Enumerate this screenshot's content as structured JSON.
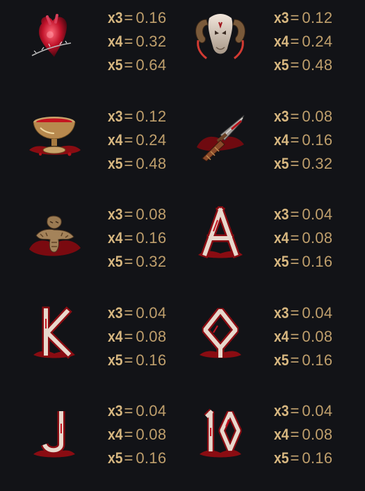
{
  "symbols": [
    {
      "name": "bleeding-heart",
      "icon": "heart-icon",
      "pays": [
        {
          "mult": "x3",
          "value": "0.16"
        },
        {
          "mult": "x4",
          "value": "0.32"
        },
        {
          "mult": "x5",
          "value": "0.64"
        }
      ]
    },
    {
      "name": "ram-skull",
      "icon": "ram-skull-icon",
      "pays": [
        {
          "mult": "x3",
          "value": "0.12"
        },
        {
          "mult": "x4",
          "value": "0.24"
        },
        {
          "mult": "x5",
          "value": "0.48"
        }
      ]
    },
    {
      "name": "blood-chalice",
      "icon": "chalice-icon",
      "pays": [
        {
          "mult": "x3",
          "value": "0.12"
        },
        {
          "mult": "x4",
          "value": "0.24"
        },
        {
          "mult": "x5",
          "value": "0.48"
        }
      ]
    },
    {
      "name": "ritual-dagger",
      "icon": "dagger-icon",
      "pays": [
        {
          "mult": "x3",
          "value": "0.08"
        },
        {
          "mult": "x4",
          "value": "0.16"
        },
        {
          "mult": "x5",
          "value": "0.32"
        }
      ]
    },
    {
      "name": "voodoo-doll",
      "icon": "voodoo-doll-icon",
      "pays": [
        {
          "mult": "x3",
          "value": "0.08"
        },
        {
          "mult": "x4",
          "value": "0.16"
        },
        {
          "mult": "x5",
          "value": "0.32"
        }
      ]
    },
    {
      "name": "letter-a",
      "icon": "letter-a-icon",
      "pays": [
        {
          "mult": "x3",
          "value": "0.04"
        },
        {
          "mult": "x4",
          "value": "0.08"
        },
        {
          "mult": "x5",
          "value": "0.16"
        }
      ]
    },
    {
      "name": "letter-k",
      "icon": "letter-k-icon",
      "pays": [
        {
          "mult": "x3",
          "value": "0.04"
        },
        {
          "mult": "x4",
          "value": "0.08"
        },
        {
          "mult": "x5",
          "value": "0.16"
        }
      ]
    },
    {
      "name": "letter-q",
      "icon": "letter-q-icon",
      "pays": [
        {
          "mult": "x3",
          "value": "0.04"
        },
        {
          "mult": "x4",
          "value": "0.08"
        },
        {
          "mult": "x5",
          "value": "0.16"
        }
      ]
    },
    {
      "name": "letter-j",
      "icon": "letter-j-icon",
      "pays": [
        {
          "mult": "x3",
          "value": "0.04"
        },
        {
          "mult": "x4",
          "value": "0.08"
        },
        {
          "mult": "x5",
          "value": "0.16"
        }
      ]
    },
    {
      "name": "number-10",
      "icon": "number-10-icon",
      "pays": [
        {
          "mult": "x3",
          "value": "0.04"
        },
        {
          "mult": "x4",
          "value": "0.08"
        },
        {
          "mult": "x5",
          "value": "0.16"
        }
      ]
    }
  ],
  "colors": {
    "background": "#121317",
    "pay_text": "#c9a873",
    "blood": "#b3121a",
    "bone": "#e8d8cc"
  },
  "letters": {
    "a": "A",
    "k": "K",
    "q": "Q",
    "j": "J",
    "ten": "10"
  }
}
